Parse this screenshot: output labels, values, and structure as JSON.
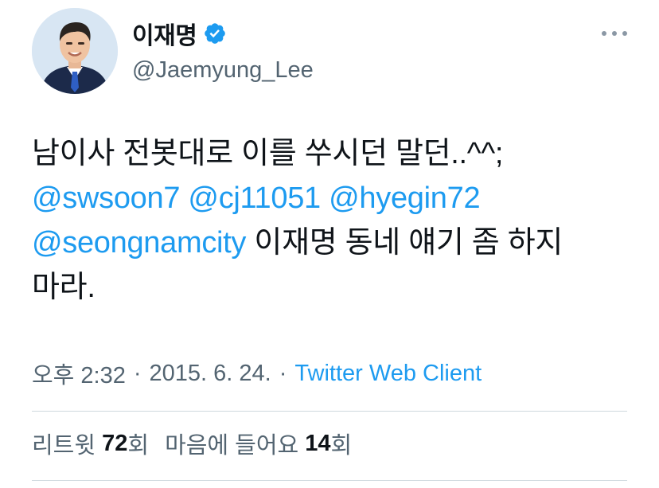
{
  "author": {
    "display_name": "이재명",
    "handle": "@Jaemyung_Lee",
    "verified_icon": "verified-badge-icon",
    "verified_color": "#1d9bf0"
  },
  "tweet": {
    "line1": "남이사 전봇대로 이를 쑤시던 말던..^^;",
    "mentions": [
      "@swsoon7",
      "@cj11051",
      "@hyegin72",
      "@seongnamcity"
    ],
    "text_after_mentions": "이재명 동네 얘기 좀 하지",
    "text_last_line": "마라."
  },
  "meta": {
    "time": "오후 2:32",
    "separator": "·",
    "date": "2015. 6. 24.",
    "source": "Twitter Web Client"
  },
  "stats": {
    "retweet_label": "리트윗",
    "retweet_count": "72",
    "retweet_unit": "회",
    "like_label": "마음에 들어요",
    "like_count": "14",
    "like_unit": "회"
  },
  "colors": {
    "accent": "#1d9bf0",
    "secondary_text": "#536471",
    "primary_text": "#0f1419"
  }
}
